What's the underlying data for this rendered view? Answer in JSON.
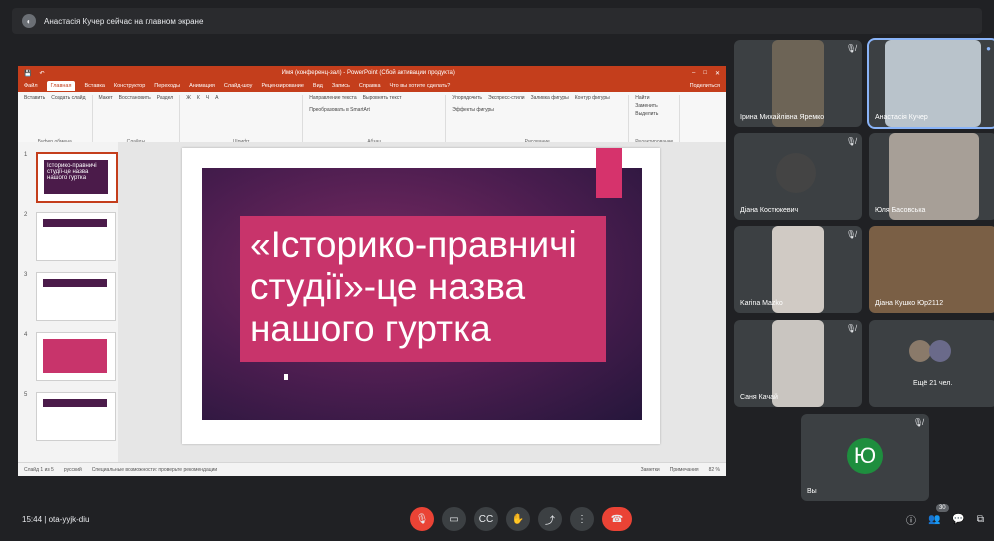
{
  "topbar": {
    "presenter_text": "Анастасія Кучер сейчас на главном экране"
  },
  "ppt": {
    "title": "Имя (конференц-зал) - PowerPoint (Сбой активации продукта)",
    "tabs": [
      "Файл",
      "Главная",
      "Вставка",
      "Конструктор",
      "Переходы",
      "Анимация",
      "Слайд-шоу",
      "Рецензирование",
      "Вид",
      "Запись",
      "Справка",
      "Что вы хотите сделать?"
    ],
    "share_label": "Поделиться",
    "ribbon": {
      "clipboard_caption": "Буфер обмена",
      "clipboard_items": [
        "Вставить",
        "Создать слайд"
      ],
      "slides_caption": "Слайды",
      "slides_items": [
        "Макет",
        "Восстановить",
        "Раздел"
      ],
      "font_caption": "Шрифт",
      "paragraph_caption": "Абзац",
      "paragraph_items": [
        "Направление текста",
        "Выровнять текст",
        "Преобразовать в SmartArt"
      ],
      "drawing_caption": "Рисование",
      "drawing_items": [
        "Упорядочить",
        "Экспресс-стили",
        "Заливка фигуры",
        "Контур фигуры",
        "Эффекты фигуры"
      ],
      "editing_caption": "Редактирование",
      "editing_items": [
        "Найти",
        "Заменить",
        "Выделить"
      ]
    },
    "slide_text": "«Історико-правничі студії»-це назва нашого гуртка",
    "thumbnail_numbers": [
      "1",
      "2",
      "3",
      "4",
      "5"
    ],
    "thumbnail_first_text": "Історико-правничі студії-це назва нашого гуртка",
    "status": {
      "slide_info": "Слайд 1 из 5",
      "language": "русский",
      "accessibility": "Специальные возможности: проверьте рекомендации",
      "notes": "Заметки",
      "comments": "Примечания",
      "zoom": "82 %"
    }
  },
  "participants": [
    {
      "name": "Ірина Михайлівна Яремко"
    },
    {
      "name": "Анастасія Кучер"
    },
    {
      "name": "Діана Костюкевич"
    },
    {
      "name": "Юля Басовська"
    },
    {
      "name": "Karina Mazko"
    },
    {
      "name": "Діана Кушко Юр2112"
    },
    {
      "name": "Саня Качай"
    },
    {
      "name": "Ещё 21 чел."
    },
    {
      "name": "Вы",
      "avatar_letter": "Ю"
    }
  ],
  "bottom": {
    "time": "15:44",
    "meeting_code": "ota-yyjk-diu",
    "participants_count": "30"
  }
}
